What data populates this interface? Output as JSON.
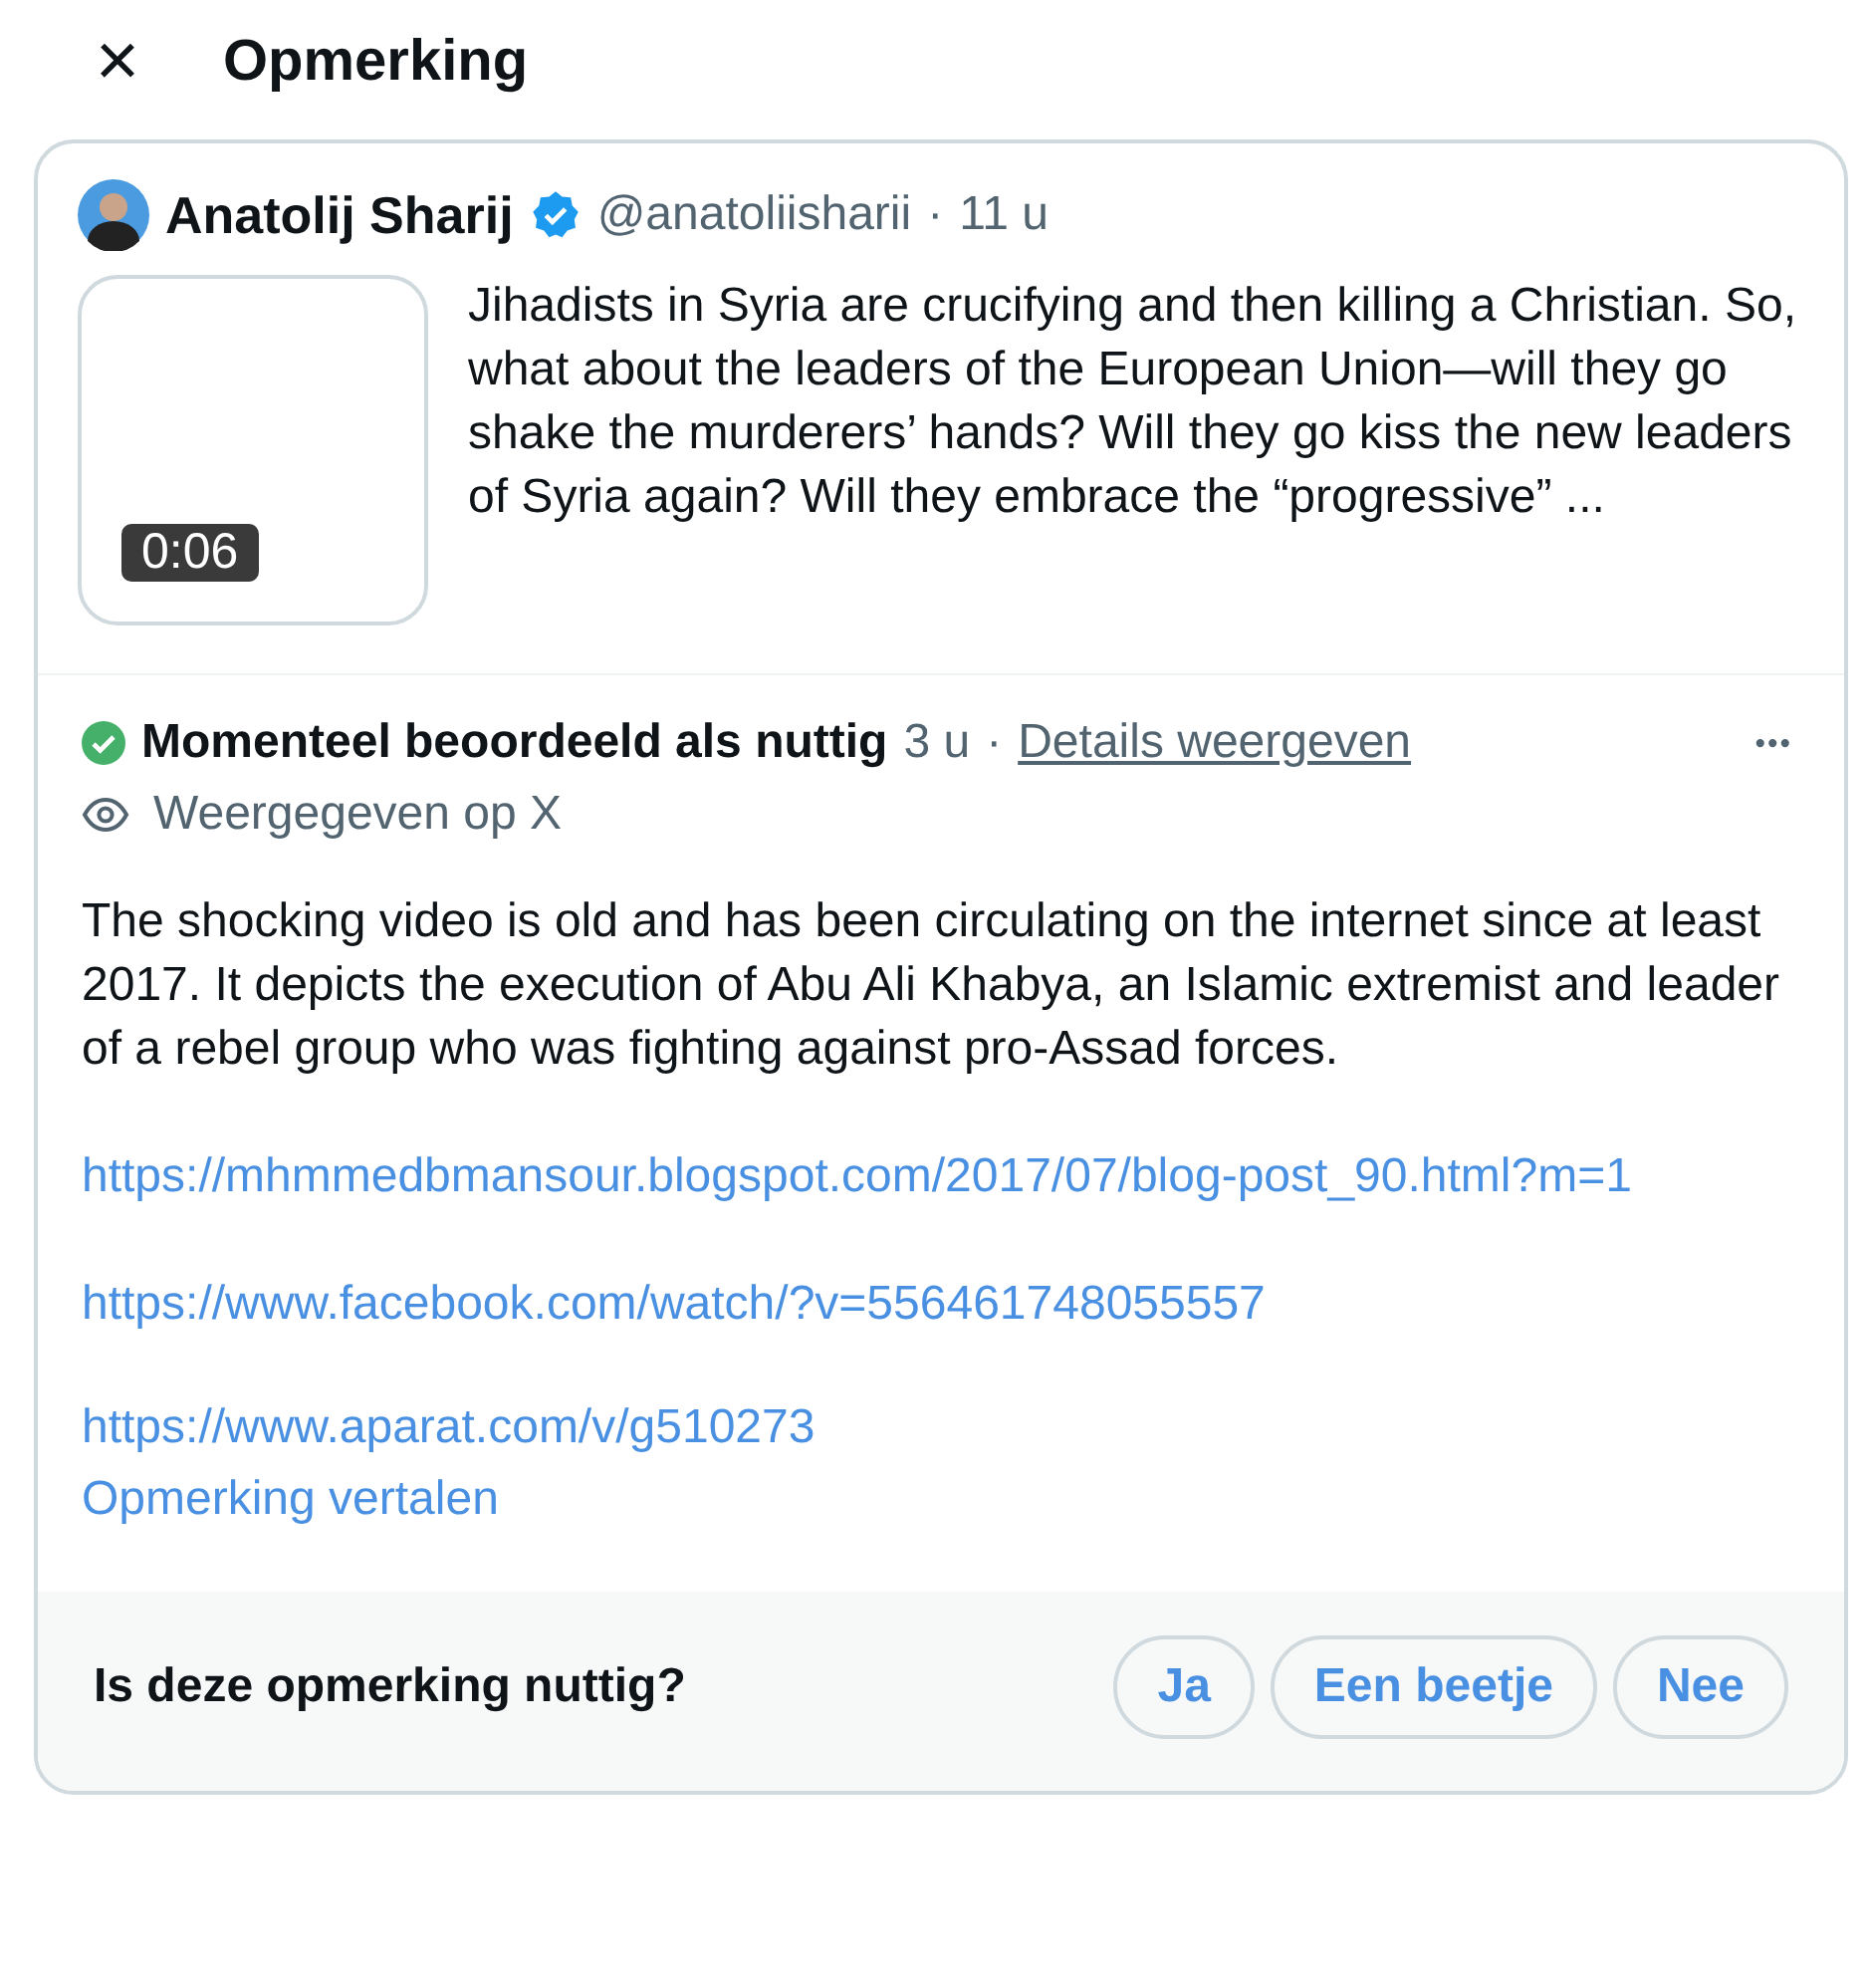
{
  "header": {
    "close": "×",
    "title": "Opmerking"
  },
  "post": {
    "author": "Anatolij Sharij",
    "verified": true,
    "handle": "@anatoliisharii",
    "separator": "·",
    "time": "11 u",
    "video_duration": "0:06",
    "text": "Jihadists in Syria are crucifying and then killing a Christian. So, what about the leaders of the European Union—will they go shake the murderers’ hands? Will they go kiss the new leaders of Syria again? Will they embrace the “progressive” ..."
  },
  "note": {
    "status": "Momenteel beoordeeld als nuttig",
    "rated_helpful": true,
    "time": "3 u",
    "separator": "·",
    "details_link": "Details weergeven",
    "more": "•••",
    "visibility": "Weergegeven op X",
    "text": "The shocking video is old and has been circulating on the internet since at least 2017. It depicts the execution of Abu Ali Khabya, an Islamic extremist and leader of a rebel group who was fighting against pro-Assad forces.",
    "links": [
      "https://mhmmedbmansour.blogspot.com/2017/07/blog-post_90.html?m=1",
      "https://www.facebook.com/watch/?v=556461748055557",
      "https://www.aparat.com/v/g510273"
    ],
    "translate": "Opmerking vertalen"
  },
  "rating": {
    "question": "Is deze opmerking nuttig?",
    "options": [
      "Ja",
      "Een beetje",
      "Nee"
    ]
  }
}
